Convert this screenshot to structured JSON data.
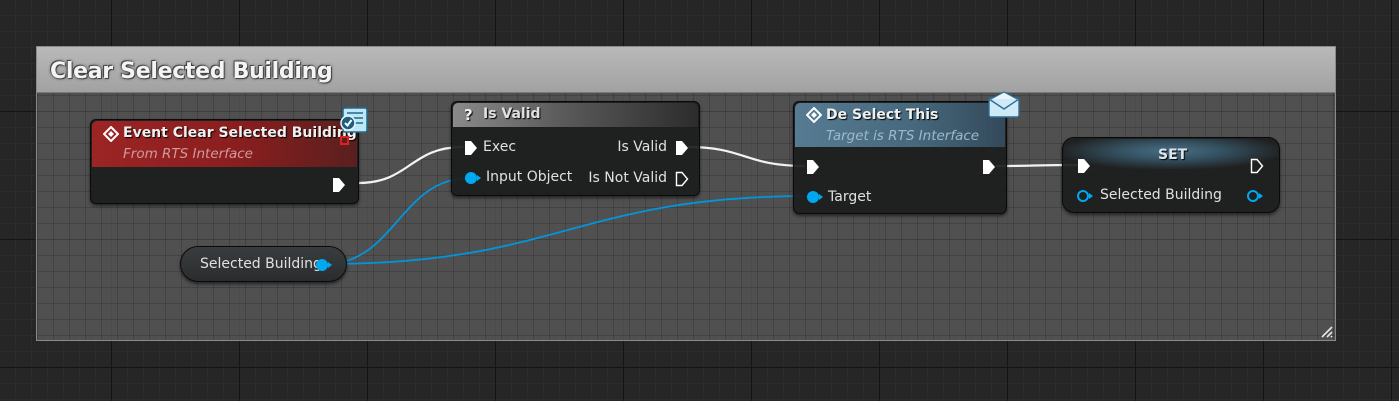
{
  "comment": {
    "title": "Clear Selected Building"
  },
  "event_node": {
    "title": "Event Clear Selected Building",
    "subtitle": "From RTS Interface",
    "header_color": "#8c1d1d"
  },
  "is_valid_node": {
    "title": "Is Valid",
    "pins": {
      "exec_in": "Exec",
      "input_object": "Input Object",
      "is_valid": "Is Valid",
      "is_not_valid": "Is Not Valid"
    }
  },
  "deselect_node": {
    "title": "De Select This",
    "subtitle": "Target is RTS Interface",
    "pins": {
      "target": "Target"
    },
    "header_color": "#4d7289"
  },
  "set_node": {
    "title": "SET",
    "pins": {
      "selected_building": "Selected Building"
    }
  },
  "getter_node": {
    "label": "Selected Building"
  },
  "colors": {
    "object_pin": "#00a8f0",
    "exec_pin": "#ffffff",
    "delegate_square": "#e02020"
  }
}
